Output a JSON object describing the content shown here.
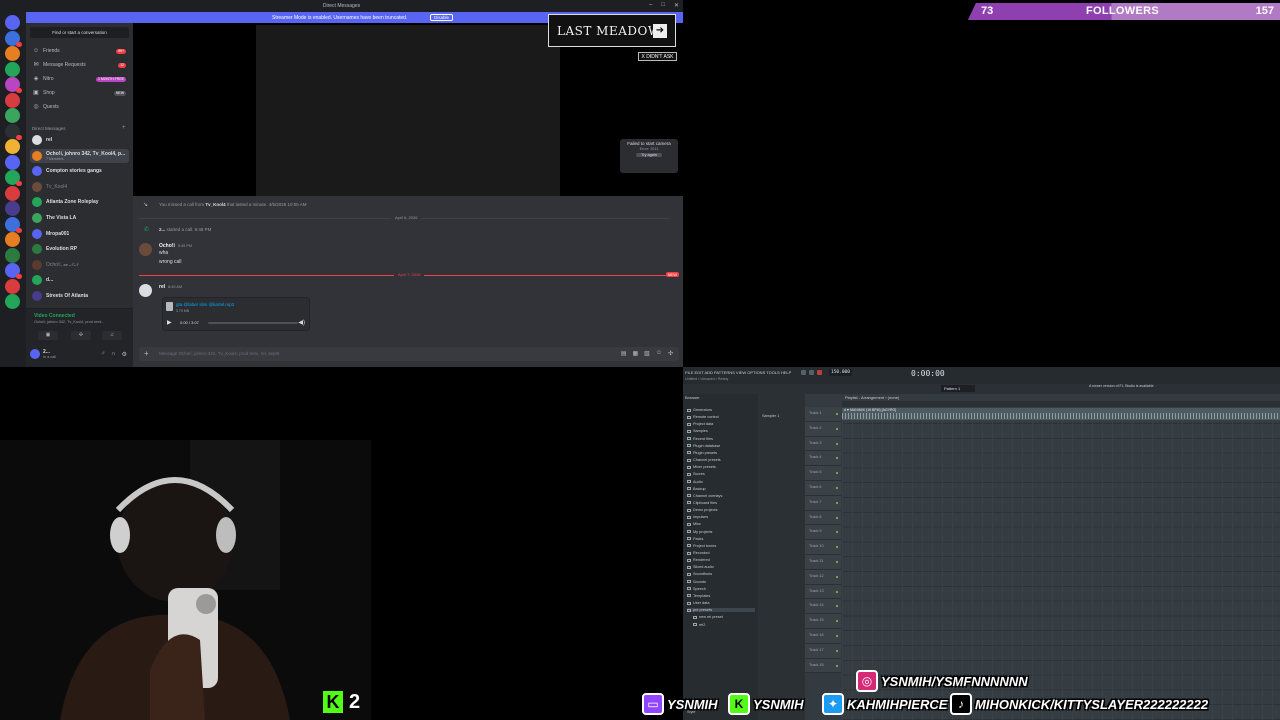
{
  "discord": {
    "window_title": "Direct Messages",
    "streamer_banner": "Streamer Mode is enabled. Usernames have been truncated.",
    "streamer_disable": "Disable",
    "search_placeholder": "Find or start a conversation",
    "nav": [
      {
        "label": "Friends",
        "pill": "99+",
        "pill_color": "#f23f43",
        "icon": "friends-icon"
      },
      {
        "label": "Message Requests",
        "pill": "12",
        "pill_color": "#f23f43",
        "icon": "message-requests-icon"
      },
      {
        "label": "Nitro",
        "pill": "1 MONTH FREE",
        "pill_color": "#b845c1",
        "icon": "nitro-icon"
      },
      {
        "label": "Shop",
        "pill": "NEW",
        "pill_color": "#4e5058",
        "icon": "shop-icon"
      },
      {
        "label": "Quests",
        "pill": "",
        "pill_color": "",
        "icon": "quests-icon"
      }
    ],
    "dm_header": "Direct Messages",
    "dms": [
      {
        "name": "rel",
        "sub": "",
        "color": "#dbdee1",
        "dim": false
      },
      {
        "name": "Ocho!i, johnro 342, Tv_Kool4, p...",
        "sub": "7 Members",
        "color": "#e67e22",
        "dim": false
      },
      {
        "name": "Compton stories gangs",
        "sub": "",
        "color": "#5865f2",
        "dim": false
      },
      {
        "name": "Tv_Kool4",
        "sub": "",
        "color": "#6b4c3b",
        "dim": true
      },
      {
        "name": "Atlanta Zone Roleplay",
        "sub": "",
        "color": "#23a55a",
        "dim": false
      },
      {
        "name": "The Vista LA",
        "sub": "",
        "color": "#3ba55d",
        "dim": false
      },
      {
        "name": "Mropa001",
        "sub": "",
        "color": "#5865f2",
        "dim": false
      },
      {
        "name": "Evolution RP",
        "sub": "",
        "color": "#2c7a3f",
        "dim": false
      },
      {
        "name": "Ocho!i, 𝓍𝓍 𝒩𝒩",
        "sub": "",
        "color": "#5b3a2e",
        "dim": true
      },
      {
        "name": "d...",
        "sub": "",
        "color": "#23a55a",
        "dim": false
      },
      {
        "name": "Streets Of Atlanta",
        "sub": "",
        "color": "#4a3c8c",
        "dim": false
      }
    ],
    "voice_status": "Video Connected",
    "voice_channel": "Ocho!i, johnro 342, Tv_Kool4, prod remi...",
    "user_name": "2...",
    "user_status": "In a call",
    "camera_fail": {
      "title": "Failed to start camera",
      "sub": "Error: 2011",
      "button": "Try again"
    },
    "chat": {
      "missed_call_prefix": "You missed a call from",
      "missed_call_user": "Tv_Kool4",
      "missed_call_suffix": "that lasted a minute.",
      "missed_call_time": "4/5/2026 10:05 AM",
      "date_divider_1": "April 6, 2026",
      "started_call_user": "2...",
      "started_call_text": "started a call.",
      "started_call_time": "9:48 PM",
      "msg1_author": "Ocho!i",
      "msg1_time": "9:49 PM",
      "msg1_lines": [
        "wha",
        "wrong call"
      ],
      "date_divider_2": "April 7, 2026",
      "new_badge": "NEW",
      "msg2_author": "rel",
      "msg2_time": "8:45 AM",
      "audio_file": "gta @laber slim @kartel.mp3",
      "audio_size": "3.79 MB",
      "audio_time": "0:00 / 3:07",
      "audio_progress": 0,
      "composer_placeholder": "Message Ocho!i, johnro 342, Tv_Kool4, prod remi, rel, sept8"
    }
  },
  "overlay": {
    "last_meadow": "LAST MEADOW",
    "dont_ask": "X DIDN'T ASK"
  },
  "followers": {
    "current": "73",
    "label": "FOLLOWERS",
    "goal": "157",
    "progress": 0.46
  },
  "kick": {
    "letter": "K",
    "count": "2"
  },
  "fl_studio": {
    "menu": "FILE  EDIT  ADD  PATTERNS  VIEW  OPTIONS  TOOLS  HELP",
    "hint": "Untitled • Unsaved • Ready",
    "bpm": "150.000",
    "time": "0:00:00",
    "pattern": "Pattern 1",
    "update": "A newer version of FL Studio is available",
    "browser_title": "Browser",
    "browser_items": [
      "Generators",
      "Remote control",
      "Project data",
      "Samples",
      "Recent files",
      "Plugin database",
      "Plugin presets",
      "Channel presets",
      "Mixer presets",
      "Scores",
      "Audio",
      "Backup",
      "Channel overlays",
      "Clipboard files",
      "Demo projects",
      "Impulses",
      "Misc",
      "My projects",
      "Packs",
      "Project bones",
      "Recorded",
      "Rendered",
      "Sliced audio",
      "Soundfonts",
      "Sounds",
      "Speech",
      "Templates",
      "User data",
      "pre presets",
      "new rel preset",
      "rel2"
    ],
    "channel_item": "Sampler 1",
    "playlist_title": "Playlist - Arrangement › (none)",
    "clip_name": "d ♥ MANIMIX (19 BPM) [AGYRO]",
    "tracks": [
      "Track 1",
      "Track 2",
      "Track 3",
      "Track 4",
      "Track 5",
      "Track 6",
      "Track 7",
      "Track 8",
      "Track 9",
      "Track 10",
      "Track 11",
      "Track 12",
      "Track 13",
      "Track 14",
      "Track 15",
      "Track 16",
      "Track 17",
      "Track 18"
    ],
    "footer": "Style"
  },
  "socials": [
    {
      "platform": "instagram",
      "icon": "instagram-icon",
      "glyph": "◎",
      "color": "#d62976",
      "handle": "YSNMIH/YSMFNNNNNN"
    },
    {
      "platform": "twitch",
      "icon": "twitch-icon",
      "glyph": "▭",
      "color": "#9146ff",
      "handle": "YSNMIH"
    },
    {
      "platform": "kick",
      "icon": "kick-icon",
      "glyph": "K",
      "color": "#53fc18",
      "handle": "YSNMIH"
    },
    {
      "platform": "twitter",
      "icon": "twitter-icon",
      "glyph": "✦",
      "color": "#1d9bf0",
      "handle": "KAHMIHPIERCE"
    },
    {
      "platform": "tiktok",
      "icon": "tiktok-icon",
      "glyph": "♪",
      "color": "#000000",
      "handle": "MIHONKICK/KITTYSLAYER222222222"
    }
  ]
}
